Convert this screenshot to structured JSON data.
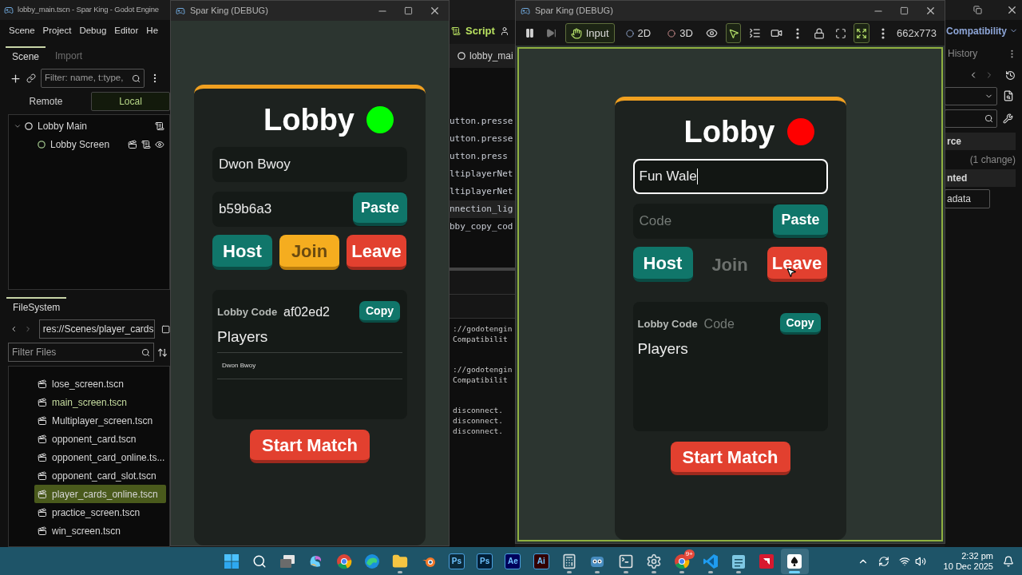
{
  "editor": {
    "title": "lobby_main.tscn - Spar King - Godot Engine",
    "menu": [
      "Scene",
      "Project",
      "Debug",
      "Editor",
      "He"
    ],
    "dock_tabs": [
      {
        "label": "Scene",
        "selected": true
      },
      {
        "label": "Import",
        "selected": false
      }
    ],
    "scene_filter": {
      "placeholder": "Filter: name, t:type,"
    },
    "scene_modes": [
      {
        "label": "Remote",
        "selected": false
      },
      {
        "label": "Local",
        "selected": true
      }
    ],
    "scene_tree": [
      {
        "name": "Lobby Main",
        "expanded": true,
        "children": [
          {
            "name": "Lobby Screen"
          }
        ]
      }
    ],
    "filesystem": {
      "tab": "FileSystem",
      "path": "res://Scenes/player_cards",
      "filter": {
        "placeholder": "Filter Files"
      },
      "files": [
        {
          "name": "lose_screen.tscn",
          "open": false,
          "selected": false
        },
        {
          "name": "main_screen.tscn",
          "open": true,
          "selected": false
        },
        {
          "name": "Multiplayer_screen.tscn",
          "open": false,
          "selected": false
        },
        {
          "name": "opponent_card.tscn",
          "open": false,
          "selected": false
        },
        {
          "name": "opponent_card_online.ts...",
          "open": false,
          "selected": false
        },
        {
          "name": "opponent_card_slot.tscn",
          "open": false,
          "selected": false
        },
        {
          "name": "player_cards_online.tscn",
          "open": false,
          "selected": true
        },
        {
          "name": "practice_screen.tscn",
          "open": false,
          "selected": false
        },
        {
          "name": "win_screen.tscn",
          "open": false,
          "selected": false
        }
      ]
    },
    "script_tab": "Script",
    "file_tab": "lobby_mai",
    "code_lines": [
      {
        "text": "utton.presse",
        "current": false
      },
      {
        "text": "utton.presse",
        "current": false
      },
      {
        "text": "utton.press",
        "current": false
      },
      {
        "text": "ltiplayerNet",
        "current": false
      },
      {
        "text": "ltiplayerNet",
        "current": false
      },
      {
        "text": "nnection_lig",
        "current": true
      },
      {
        "text": "bby_copy_cod",
        "current": false
      }
    ],
    "output_blocks": [
      [
        "://godotengin",
        "Compatibilit"
      ],
      [
        "://godotengin",
        "Compatibilit"
      ],
      [
        "disconnect.",
        "disconnect.",
        "disconnect."
      ]
    ],
    "renderer": "Compatibility",
    "history_tab": "History",
    "inspector_sections": [
      {
        "kind": "header",
        "text": "rce"
      },
      {
        "kind": "note",
        "text": "(1 change)"
      },
      {
        "kind": "header",
        "text": "nted"
      },
      {
        "kind": "button",
        "text": "adata"
      }
    ]
  },
  "game_windows": [
    {
      "title": "Spar King (DEBUG)",
      "kind": "plain",
      "lobby": {
        "title": "Lobby",
        "color": "#00ff00",
        "name_field": {
          "value": "Dwon Bwoy",
          "focused": false
        },
        "code_field": {
          "value": "b59b6a3"
        },
        "paste": "Paste",
        "buttons": [
          {
            "label": "Host",
            "kind": "host",
            "disabled": false
          },
          {
            "label": "Join",
            "kind": "join",
            "disabled": false
          },
          {
            "label": "Leave",
            "kind": "leave",
            "disabled": false
          }
        ],
        "lobby_code": {
          "label": "Lobby Code",
          "value": "af02ed2"
        },
        "copy": "Copy",
        "players_title": "Players",
        "players": [
          "Dwon Bwoy"
        ],
        "start": "Start Match"
      }
    },
    {
      "title": "Spar King (DEBUG)",
      "kind": "embedded",
      "toolbar": [
        {
          "kind": "pause",
          "selected": false
        },
        {
          "kind": "next",
          "selected": false
        },
        {
          "kind": "input",
          "label": "Input",
          "selected": true
        },
        {
          "kind": "flat",
          "label": "2D",
          "selected": false
        },
        {
          "kind": "depth",
          "label": "3D",
          "selected": false
        },
        {
          "kind": "eye",
          "selected": false
        },
        {
          "kind": "select",
          "selected": true
        },
        {
          "kind": "list",
          "selected": false
        },
        {
          "kind": "camera",
          "selected": false
        },
        {
          "kind": "more",
          "selected": false
        },
        {
          "kind": "lock",
          "selected": false
        },
        {
          "kind": "fullscreen",
          "selected": false
        },
        {
          "kind": "expand",
          "selected": true
        },
        {
          "kind": "more",
          "selected": false
        }
      ],
      "size": "662x773",
      "lobby": {
        "title": "Lobby",
        "color": "#ff0000",
        "name_field": {
          "value": "Fun Wale",
          "focused": true
        },
        "code_field": {
          "placeholder": "Code"
        },
        "paste": "Paste",
        "buttons": [
          {
            "label": "Host",
            "kind": "host",
            "disabled": false
          },
          {
            "label": "Join",
            "kind": "join",
            "disabled": true
          },
          {
            "label": "Leave",
            "kind": "leave",
            "disabled": false
          }
        ],
        "lobby_code": {
          "label": "Lobby Code",
          "placeholder": "Code"
        },
        "copy": "Copy",
        "players_title": "Players",
        "start": "Start Match"
      }
    }
  ],
  "taskbar": {
    "apps": [
      {
        "kind": "start",
        "running": false,
        "selected": false
      },
      {
        "kind": "search",
        "running": false,
        "selected": false
      },
      {
        "kind": "taskview",
        "running": false,
        "selected": false
      },
      {
        "kind": "copilot",
        "running": false,
        "selected": false
      },
      {
        "kind": "chrome",
        "running": false,
        "selected": false
      },
      {
        "kind": "edge",
        "running": false,
        "selected": false
      },
      {
        "kind": "explorer",
        "running": true,
        "selected": false
      },
      {
        "kind": "blender",
        "running": false,
        "selected": false
      },
      {
        "kind": "tile",
        "label": "Ps",
        "color": "#0b2a3a",
        "running": false,
        "selected": false
      },
      {
        "kind": "tile",
        "label": "Ps",
        "color": "#001e36",
        "running": false,
        "selected": false
      },
      {
        "kind": "tile",
        "label": "Ae",
        "color": "#00005b",
        "running": false,
        "selected": false
      },
      {
        "kind": "tile",
        "label": "Ai",
        "color": "#330000",
        "running": false,
        "selected": false
      },
      {
        "kind": "calculator",
        "running": true,
        "selected": false
      },
      {
        "kind": "godot",
        "running": true,
        "selected": false
      },
      {
        "kind": "terminal",
        "running": true,
        "selected": false
      },
      {
        "kind": "settings",
        "running": true,
        "selected": false
      },
      {
        "kind": "chrome",
        "badge": "9+",
        "running": true,
        "selected": false
      },
      {
        "kind": "vscode",
        "running": true,
        "selected": false
      },
      {
        "kind": "notepad",
        "running": true,
        "selected": false
      },
      {
        "kind": "amd",
        "running": false,
        "selected": false
      },
      {
        "kind": "game",
        "running": true,
        "selected": true
      }
    ],
    "time": "2:32 pm",
    "date": "10 Dec 2025"
  }
}
